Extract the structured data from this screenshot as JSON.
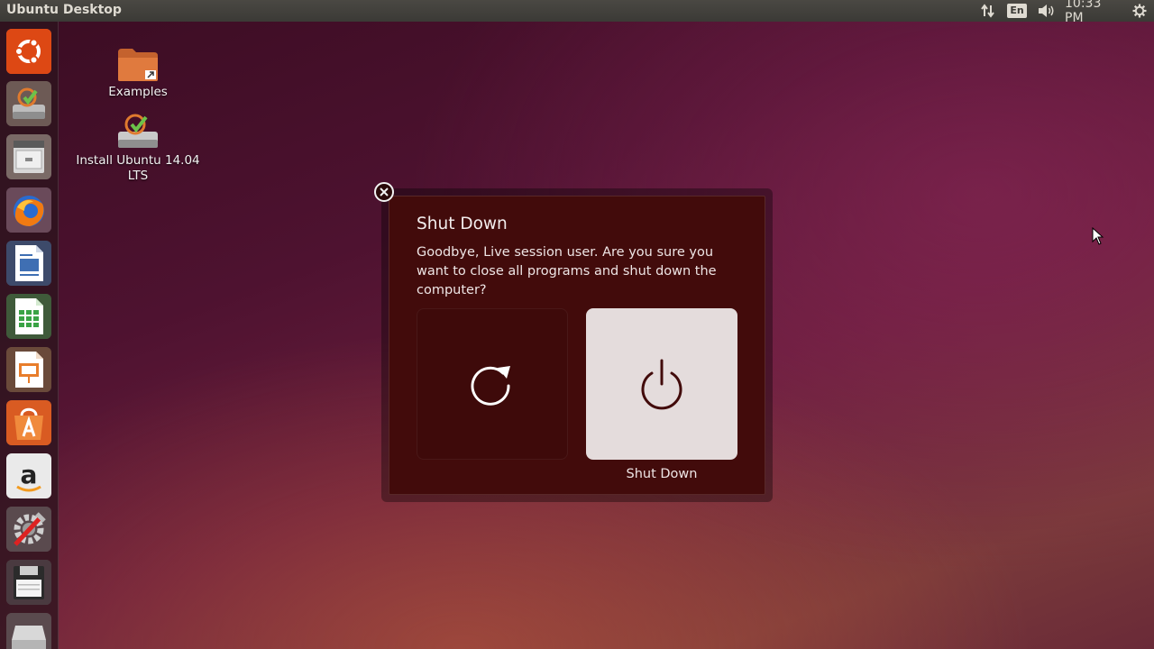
{
  "top_panel": {
    "app_title": "Ubuntu Desktop",
    "keyboard_layout": "En",
    "clock": "10:33 PM",
    "indicators": [
      "network-updown-icon",
      "keyboard-layout-icon",
      "volume-icon",
      "clock",
      "gear-icon"
    ]
  },
  "launcher": {
    "items": [
      {
        "name": "dash-home",
        "icon": "ubuntu-logo-icon"
      },
      {
        "name": "install-ubuntu",
        "icon": "installer-icon"
      },
      {
        "name": "files",
        "icon": "file-cabinet-icon"
      },
      {
        "name": "firefox",
        "icon": "firefox-icon"
      },
      {
        "name": "libreoffice-writer",
        "icon": "writer-icon"
      },
      {
        "name": "libreoffice-calc",
        "icon": "calc-icon"
      },
      {
        "name": "libreoffice-impress",
        "icon": "impress-icon"
      },
      {
        "name": "ubuntu-software-center",
        "icon": "software-center-icon"
      },
      {
        "name": "amazon",
        "icon": "amazon-icon"
      },
      {
        "name": "system-settings",
        "icon": "settings-icon"
      },
      {
        "name": "floppy",
        "icon": "floppy-icon"
      },
      {
        "name": "drive",
        "icon": "drive-icon"
      }
    ]
  },
  "desktop": {
    "icons": [
      {
        "label": "Examples",
        "icon": "folder-link-icon"
      },
      {
        "label": "Install Ubuntu 14.04 LTS",
        "icon": "installer-icon"
      }
    ]
  },
  "dialog": {
    "title": "Shut Down",
    "message": "Goodbye, Live session user. Are you sure you want to close all programs and shut down the computer?",
    "options": [
      {
        "name": "restart",
        "icon": "restart-icon",
        "label": "",
        "selected": false
      },
      {
        "name": "shut-down",
        "icon": "power-icon",
        "label": "Shut Down",
        "selected": true
      }
    ]
  },
  "colors": {
    "dialog_bg": "#420b0b",
    "selected_option_bg": "#e4dcdc",
    "panel_bg": "#3b3a36"
  }
}
